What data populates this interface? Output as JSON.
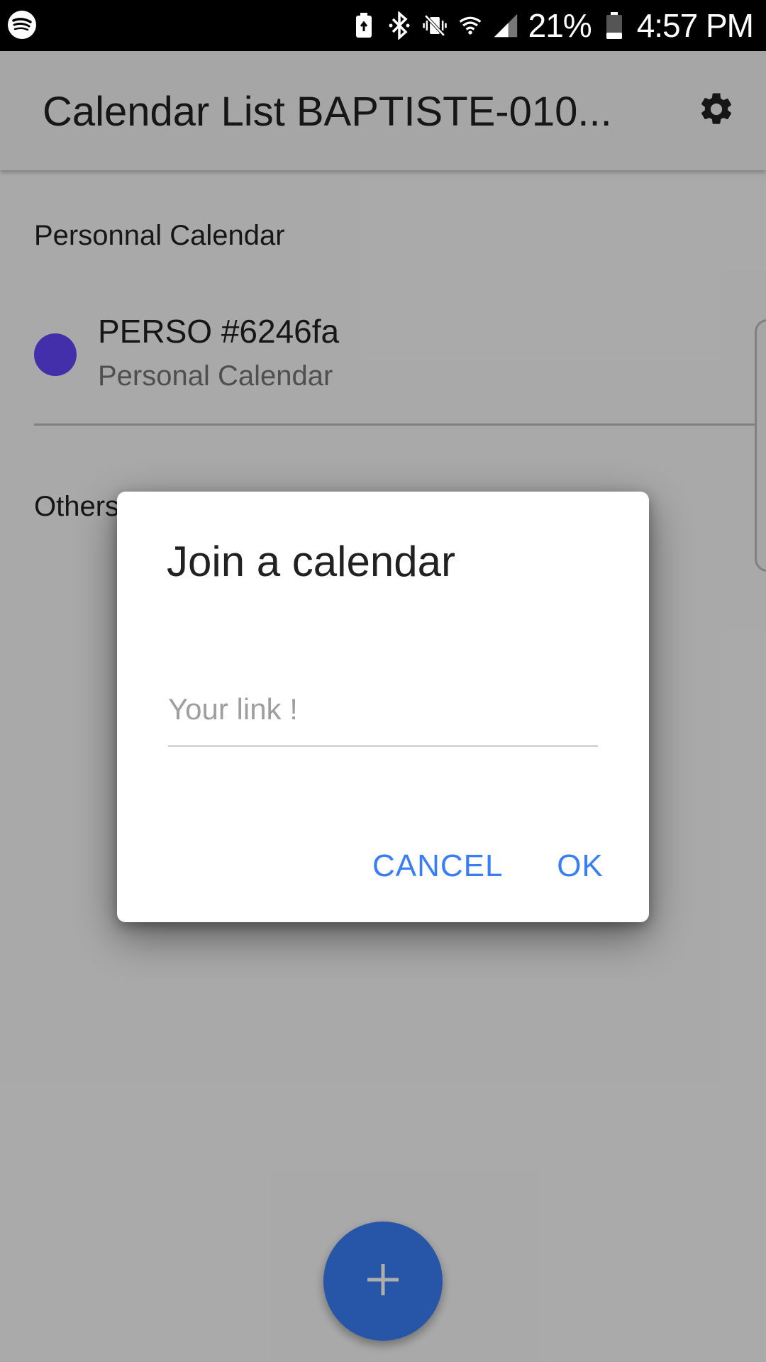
{
  "status_bar": {
    "battery_percent": "21%",
    "time": "4:57 PM",
    "icons": [
      "spotify-icon",
      "battery-saver-icon",
      "bluetooth-icon",
      "vibrate-icon",
      "wifi-icon",
      "signal-icon",
      "battery-icon"
    ]
  },
  "app_bar": {
    "title": "Calendar List BAPTISTE-010...",
    "settings_icon": "gear-icon"
  },
  "sections": {
    "personal_header": "Personnal Calendar",
    "others_header": "Others"
  },
  "calendars": [
    {
      "name": "PERSO #6246fa",
      "subtitle": "Personal Calendar",
      "color": "#6246fa"
    }
  ],
  "dialog": {
    "title": "Join a calendar",
    "input_placeholder": "Your link !",
    "input_value": "",
    "cancel_label": "CANCEL",
    "ok_label": "OK"
  },
  "fab": {
    "icon": "plus-icon"
  },
  "colors": {
    "accent": "#3a7ef7",
    "status_bar": "#000000",
    "scrim": "rgba(0,0,0,0.32)"
  }
}
